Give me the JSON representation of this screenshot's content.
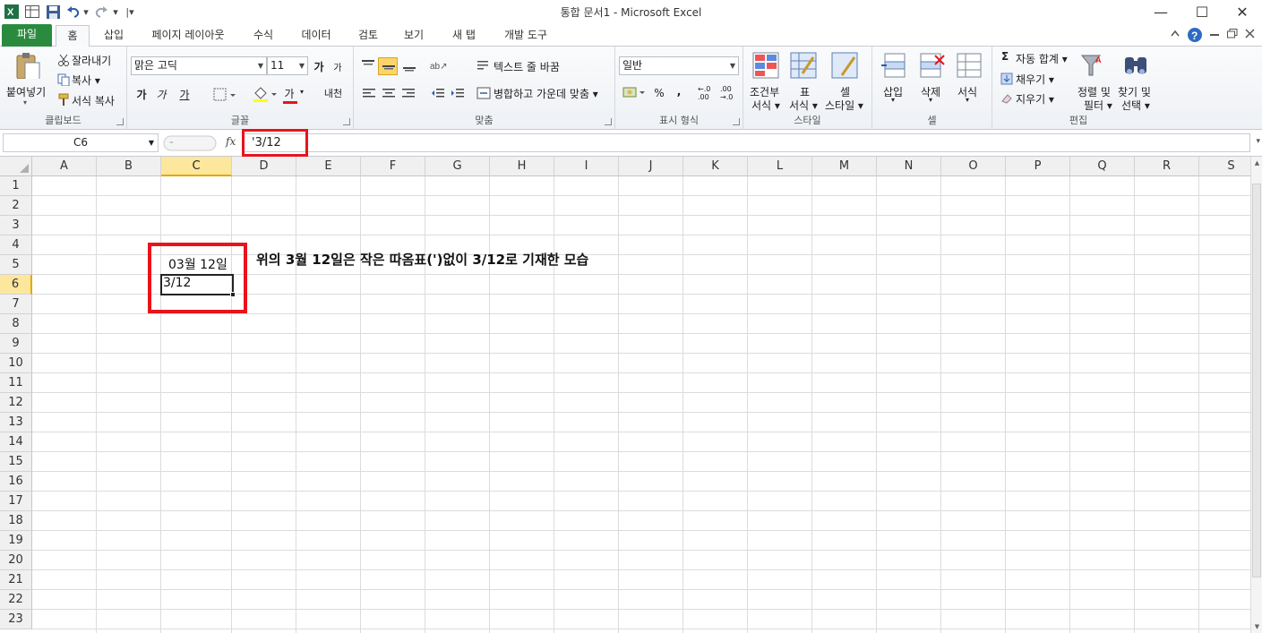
{
  "window": {
    "title": "통합 문서1  -  Microsoft Excel",
    "controls": {
      "minimize": "—",
      "maximize": "☐",
      "close": "✕"
    }
  },
  "qat": {
    "customize": "|▾",
    "undo_arrow": "▾",
    "redo_arrow": "▾"
  },
  "tabs": [
    "파일",
    "홈",
    "삽입",
    "페이지 레이아웃",
    "수식",
    "데이터",
    "검토",
    "보기",
    "새 탭",
    "개발 도구"
  ],
  "ribbon": {
    "clipboard": {
      "label": "클립보드",
      "paste": "붙여넣기",
      "cut": "잘라내기",
      "copy": "복사 ▾",
      "format_painter": "서식 복사"
    },
    "font": {
      "label": "글꼴",
      "font_name": "맑은 고딕",
      "font_size": "11",
      "grow": "가",
      "shrink": "가",
      "bold": "가",
      "italic": "가",
      "underline": "가",
      "font_color": "가",
      "phonetic": "내천"
    },
    "alignment": {
      "label": "맞춤",
      "wrap_text": "텍스트 줄 바꿈",
      "merge_center": "병합하고 가운데 맞춤 ▾"
    },
    "number": {
      "label": "표시 형식",
      "format": "일반",
      "percent": "%",
      "comma": ",",
      "inc_decimal": "←.0 .00",
      "dec_decimal": ".00 →.0"
    },
    "styles": {
      "label": "스타일",
      "conditional": [
        "조건부",
        "서식 ▾"
      ],
      "table": [
        "표",
        "서식 ▾"
      ],
      "cell_styles": [
        "셀",
        "스타일 ▾"
      ]
    },
    "cells": {
      "label": "셀",
      "insert": "삽입",
      "delete": "삭제",
      "format": "서식"
    },
    "editing": {
      "label": "편집",
      "autosum": "자동 합계 ▾",
      "fill": "채우기 ▾",
      "clear": "지우기 ▾",
      "sort_filter": [
        "정렬 및",
        "필터 ▾"
      ],
      "find_select": [
        "찾기 및",
        "선택 ▾"
      ]
    }
  },
  "formula_bar": {
    "name_box": "C6",
    "fx": "fx",
    "value": "'3/12"
  },
  "columns": [
    "A",
    "B",
    "C",
    "D",
    "E",
    "F",
    "G",
    "H",
    "I",
    "J",
    "K",
    "L",
    "M",
    "N",
    "O",
    "P",
    "Q",
    "R",
    "S"
  ],
  "rows": [
    "1",
    "2",
    "3",
    "4",
    "5",
    "6",
    "7",
    "8",
    "9",
    "10",
    "11",
    "12",
    "13",
    "14",
    "15",
    "16",
    "17",
    "18",
    "19",
    "20",
    "21",
    "22",
    "23"
  ],
  "cells": {
    "C5": "03월 12일",
    "C6": "3/12",
    "D5": "위의 3월 12일은 작은 따옴표(')없이 3/12로 기재한 모습"
  },
  "active_cell": "C6",
  "colors": {
    "file_tab": "#2a8b3e",
    "highlight_box": "#e8141c",
    "selected_header": "#fde79c"
  }
}
